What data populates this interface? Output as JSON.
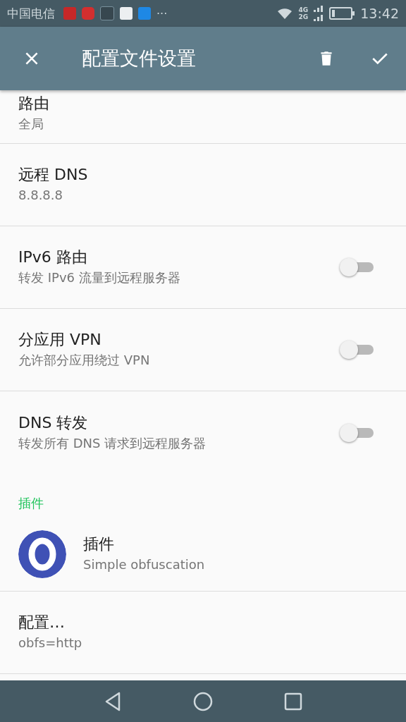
{
  "status_bar": {
    "carrier": "中国电信",
    "more": "···",
    "network_top": "4G",
    "network_bottom": "2G",
    "time": "13:42"
  },
  "app_bar": {
    "title": "配置文件设置"
  },
  "items": [
    {
      "kind": "text",
      "title": "路由",
      "summary": "全局"
    },
    {
      "kind": "text",
      "title": "远程 DNS",
      "summary": "8.8.8.8"
    },
    {
      "kind": "switch",
      "title": "IPv6 路由",
      "summary": "转发 IPv6 流量到远程服务器",
      "on": false
    },
    {
      "kind": "switch",
      "title": "分应用 VPN",
      "summary": "允许部分应用绕过 VPN",
      "on": false
    },
    {
      "kind": "switch",
      "title": "DNS 转发",
      "summary": "转发所有 DNS 请求到远程服务器",
      "on": false
    },
    {
      "kind": "category",
      "title": "插件"
    },
    {
      "kind": "plugin",
      "title": "插件",
      "summary": "Simple obfuscation"
    },
    {
      "kind": "text",
      "title": "配置…",
      "summary": "obfs=http"
    }
  ]
}
